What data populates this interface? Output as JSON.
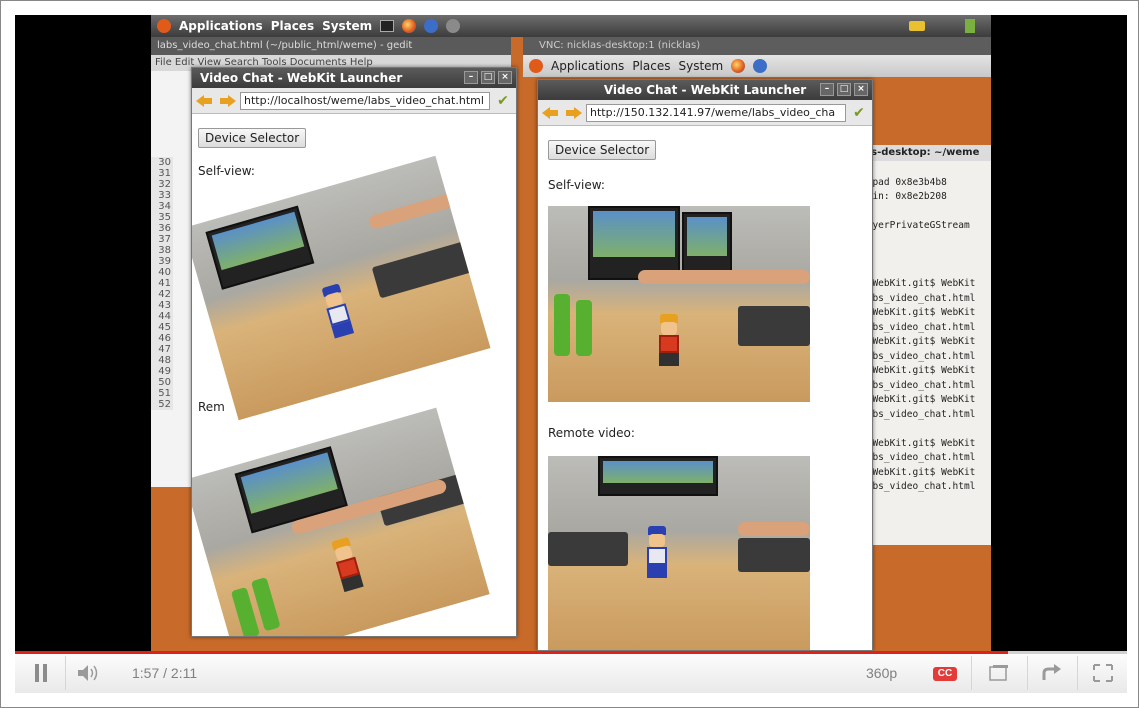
{
  "desktop_left": {
    "panel": {
      "apps": "Applications",
      "places": "Places",
      "system": "System"
    },
    "gedit_title": "labs_video_chat.html (~/public_html/weme) - gedit",
    "gedit_menu": "File  Edit  View  Search  Tools  Documents  Help",
    "line_numbers": [
      "30",
      "31",
      "32",
      "33",
      "34",
      "35",
      "36",
      "37",
      "38",
      "39",
      "40",
      "41",
      "42",
      "43",
      "44",
      "45",
      "46",
      "47",
      "48",
      "49",
      "50",
      "51",
      "52"
    ],
    "window": {
      "title": "Video Chat - WebKit Launcher",
      "url": "http://localhost/weme/labs_video_chat.html",
      "device_selector": "Device Selector",
      "self_view": "Self-view:",
      "remote_partial": "Rem"
    }
  },
  "desktop_right": {
    "vnc_title": "VNC: nicklas-desktop:1 (nicklas)",
    "panel": {
      "apps": "Applications",
      "places": "Places",
      "system": "System"
    },
    "window": {
      "title": "Video Chat - WebKit Launcher",
      "url": "http://150.132.141.97/weme/labs_video_cha",
      "device_selector": "Device Selector",
      "self_view": "Self-view:",
      "remote_video": "Remote video:"
    },
    "terminal": {
      "title": "las-desktop: ~/weme",
      "lines": [
        "p",
        "rcpad 0x8e3b4b8",
        "yBin: 0x8e2b208",
        "",
        "layerPrivateGStream",
        "",
        "",
        "",
        "e/WebKit.git$ WebKit",
        "labs_video_chat.html",
        "e/WebKit.git$ WebKit",
        "labs_video_chat.html",
        "e/WebKit.git$ WebKit",
        "labs_video_chat.html",
        "e/WebKit.git$ WebKit",
        "labs_video_chat.html",
        "e/WebKit.git$ WebKit",
        "labs_video_chat.html",
        "",
        "e/WebKit.git$ WebKit",
        "labs_video_chat.html",
        "e/WebKit.git$ WebKit",
        "labs_video_chat.html"
      ]
    }
  },
  "player": {
    "time": "1:57 / 2:11",
    "progress_fraction": 0.893,
    "quality": "360p",
    "cc": "CC",
    "icons": [
      "pause-icon",
      "volume-icon",
      "cc-icon",
      "popout-icon",
      "share-icon",
      "fullscreen-icon"
    ]
  }
}
